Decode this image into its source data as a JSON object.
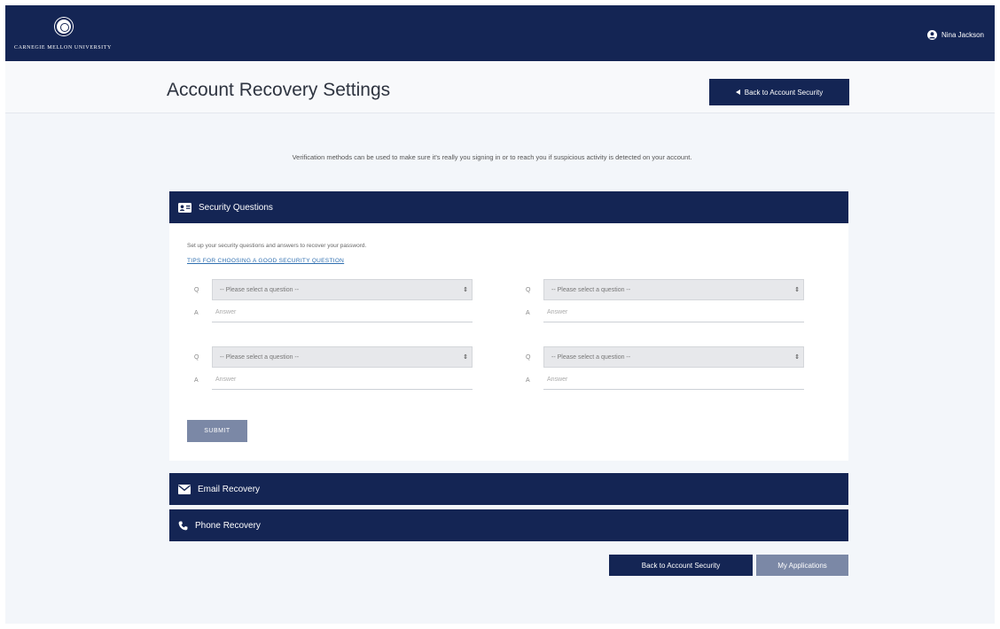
{
  "header": {
    "logo_text": "CARNEGIE MELLON UNIVERSITY",
    "user_name": "Nina Jackson",
    "user_icon": "user-circle-icon"
  },
  "page": {
    "title": "Account Recovery Settings",
    "back_top_label": "Back to Account Security",
    "back_top_icon": "arrow-left-icon",
    "intro": "Verification methods can be used to make sure it's really you signing in or to reach you if suspicious activity is detected on your account."
  },
  "security_questions": {
    "title": "Security Questions",
    "icon": "id-card-icon",
    "help_text": "Set up your security questions and answers to recover your password.",
    "tips_link": "TIPS FOR CHOOSING A GOOD SECURITY QUESTION",
    "questions": [
      {
        "q_index": "Q",
        "placeholder": "-- Please select a question --",
        "a_index": "A",
        "answer_placeholder": "Answer"
      },
      {
        "q_index": "Q",
        "placeholder": "-- Please select a question --",
        "a_index": "A",
        "answer_placeholder": "Answer"
      },
      {
        "q_index": "Q",
        "placeholder": "-- Please select a question --",
        "a_index": "A",
        "answer_placeholder": "Answer"
      },
      {
        "q_index": "Q",
        "placeholder": "-- Please select a question --",
        "a_index": "A",
        "answer_placeholder": "Answer"
      }
    ],
    "submit_label": "SUBMIT"
  },
  "email_recovery": {
    "title": "Email Recovery",
    "icon": "envelope-icon"
  },
  "phone_recovery": {
    "title": "Phone Recovery",
    "icon": "phone-icon"
  },
  "footer_buttons": {
    "back_label": "Back to Account Security",
    "apps_label": "My Applications"
  },
  "colors": {
    "navy": "#142554",
    "muted_button": "#7b88a6",
    "link": "#2f6fb0",
    "page_bg": "#f3f6fa"
  }
}
